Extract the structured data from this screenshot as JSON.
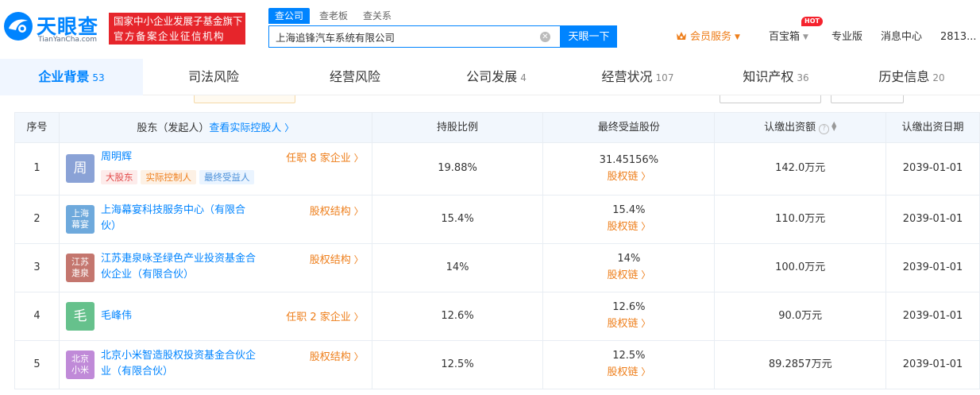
{
  "header": {
    "logo_text": "天眼查",
    "logo_sub": "TianYanCha.com",
    "banner_line1": "国家中小企业发展子基金旗下",
    "banner_line2": "官方备案企业征信机构",
    "search_tabs": [
      "查公司",
      "查老板",
      "查关系"
    ],
    "search_value": "上海追锋汽车系统有限公司",
    "search_button": "天眼一下",
    "vip": "会员服务",
    "baibao": "百宝箱",
    "hot": "HOT",
    "pro": "专业版",
    "messages": "消息中心",
    "user": "2813..."
  },
  "tabs": [
    {
      "label": "企业背景",
      "count": "53"
    },
    {
      "label": "司法风险",
      "count": ""
    },
    {
      "label": "经营风险",
      "count": ""
    },
    {
      "label": "公司发展",
      "count": "4"
    },
    {
      "label": "经营状况",
      "count": "107"
    },
    {
      "label": "知识产权",
      "count": "36"
    },
    {
      "label": "历史信息",
      "count": "20"
    }
  ],
  "table": {
    "headers": {
      "index": "序号",
      "holder": "股东（发起人）",
      "holder_link": "查看实际控股人",
      "ratio": "持股比例",
      "benefit": "最终受益股份",
      "capital": "认缴出资额",
      "date": "认缴出资日期"
    },
    "rows": [
      {
        "index": "1",
        "avatar": "周",
        "name_l1": "周明辉",
        "name_l2": "",
        "right_link": "任职 8 家企业",
        "tags": [
          "大股东",
          "实际控制人",
          "最终受益人"
        ],
        "ratio": "19.88%",
        "benefit": "31.45156%",
        "chain": "股权链",
        "capital": "142.0万元",
        "date": "2039-01-01"
      },
      {
        "index": "2",
        "avatar": "上海幕宴",
        "name_l1": "上海幕宴科技服务中心（有限合",
        "name_l2": "伙）",
        "right_link": "股权结构",
        "tags": [],
        "ratio": "15.4%",
        "benefit": "15.4%",
        "chain": "股权链",
        "capital": "110.0万元",
        "date": "2039-01-01"
      },
      {
        "index": "3",
        "avatar": "江苏疌泉",
        "name_l1": "江苏疌泉咏圣绿色产业投资基金合",
        "name_l2": "伙企业（有限合伙）",
        "right_link": "股权结构",
        "tags": [],
        "ratio": "14%",
        "benefit": "14%",
        "chain": "股权链",
        "capital": "100.0万元",
        "date": "2039-01-01"
      },
      {
        "index": "4",
        "avatar": "毛",
        "name_l1": "毛峰伟",
        "name_l2": "",
        "right_link": "任职 2 家企业",
        "tags": [],
        "ratio": "12.6%",
        "benefit": "12.6%",
        "chain": "股权链",
        "capital": "90.0万元",
        "date": "2039-01-01"
      },
      {
        "index": "5",
        "avatar": "北京小米",
        "name_l1": "北京小米智造股权投资基金合伙企",
        "name_l2": "业（有限合伙）",
        "right_link": "股权结构",
        "tags": [],
        "ratio": "12.5%",
        "benefit": "12.5%",
        "chain": "股权链",
        "capital": "89.2857万元",
        "date": "2039-01-01"
      }
    ]
  },
  "colors": {
    "brand": "#0084ff",
    "orange": "#ee7e1a",
    "banner_red": "#e6252b",
    "avatar_1": "#8aa2d6",
    "avatar_2": "#6ea9dc",
    "avatar_3": "#c4766e",
    "avatar_4": "#66c18c",
    "avatar_5": "#c08ad8"
  }
}
